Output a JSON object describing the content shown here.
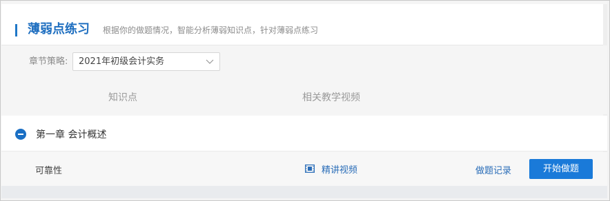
{
  "header": {
    "title": "薄弱点练习",
    "description": "根据你的做题情况，智能分析薄弱知识点，针对薄弱点练习"
  },
  "filter": {
    "label": "章节策略:",
    "selected": "2021年初级会计实务"
  },
  "table": {
    "columns": [
      "知识点",
      "相关教学视频"
    ]
  },
  "chapters": [
    {
      "title": "第一章 会计概述",
      "points": [
        {
          "name": "可靠性",
          "video_label": "精讲视频",
          "record_label": "做题记录",
          "start_label": "开始做题"
        }
      ]
    }
  ],
  "colors": {
    "accent": "#1a7ad9",
    "link": "#2a6db8",
    "title": "#1f6fc0"
  },
  "icons": {
    "collapse": "minus-circle-icon",
    "video": "film-icon",
    "dropdown": "chevron-down-icon"
  }
}
